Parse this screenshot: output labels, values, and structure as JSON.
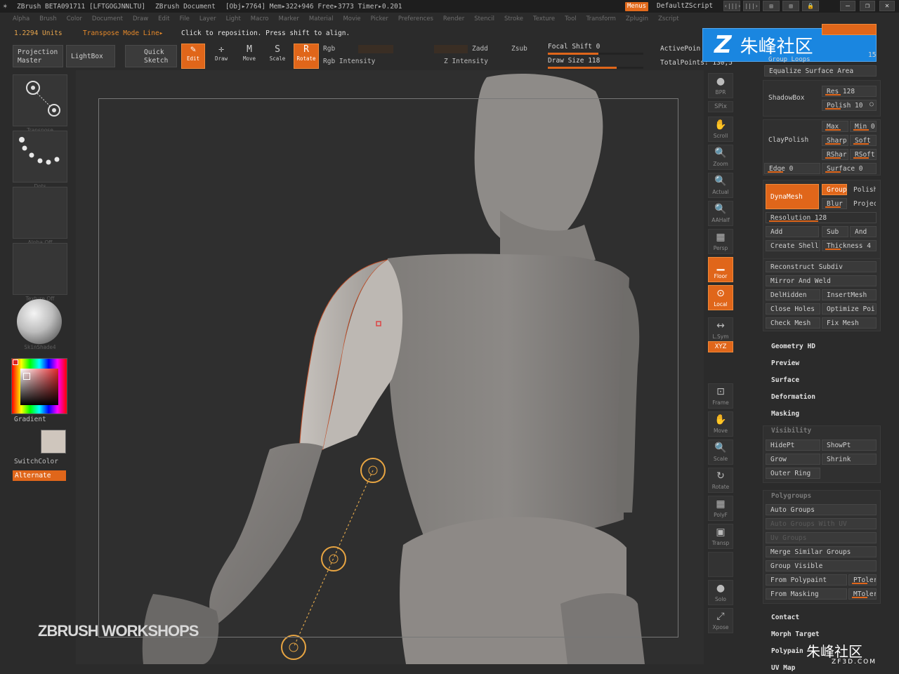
{
  "titlebar": {
    "app": "ZBrush BETA091711 [LFTGOGJNNLTU]",
    "document": "ZBrush Document",
    "stats": "[Obj▸7764] Mem▸322+946 Free▸3773 Timer▸0.201",
    "menus_label": "Menus",
    "script_label": "DefaultZScript"
  },
  "menubar": [
    "Alpha",
    "Brush",
    "Color",
    "Document",
    "Draw",
    "Edit",
    "File",
    "Layer",
    "Light",
    "Macro",
    "Marker",
    "Material",
    "Movie",
    "Picker",
    "Preferences",
    "Render",
    "Stencil",
    "Stroke",
    "Texture",
    "Tool",
    "Transform",
    "Zplugin",
    "Zscript"
  ],
  "infobar": {
    "units": "1.2294 Units",
    "mode": "Transpose Mode Line▸",
    "tip": "Click to reposition. Press shift to align."
  },
  "toolbar": {
    "projection_master": "Projection Master",
    "lightbox": "LightBox",
    "quick_sketch": "Quick Sketch",
    "edit": "Edit",
    "draw": "Draw",
    "move": "Move",
    "scale": "Scale",
    "rotate": "Rotate",
    "rgb": "Rgb",
    "zadd": "Zadd",
    "zsub": "Zsub",
    "rgb_intensity": "Rgb Intensity",
    "z_intensity": "Z Intensity",
    "focal_shift": "Focal Shift 0",
    "draw_size": "Draw Size 118",
    "active_points": "ActivePoin",
    "total_points": "TotalPoints: 130,5"
  },
  "left_shelf": {
    "transpose_caption": "Transpose",
    "dots_caption": "Dots",
    "alpha_caption": "Alpha Off",
    "texture_caption": "Texture Off",
    "material_caption": "SkinShade4",
    "gradient": "Gradient",
    "switch_color": "SwitchColor",
    "alternate": "Alternate"
  },
  "viewport": {
    "watermark": "ZBRUSH WORKSHOPS"
  },
  "right_shelf": [
    {
      "icon": "bpr-icon",
      "glyph": "●",
      "label": "BPR",
      "orange": false
    },
    {
      "icon": "spix-icon",
      "glyph": "",
      "label": "SPix",
      "orange": false
    },
    {
      "icon": "scroll-icon",
      "glyph": "✋",
      "label": "Scroll",
      "orange": false
    },
    {
      "icon": "zoom-icon",
      "glyph": "🔍",
      "label": "Zoom",
      "orange": false
    },
    {
      "icon": "actual-icon",
      "glyph": "🔍",
      "label": "Actual",
      "orange": false
    },
    {
      "icon": "aahalf-icon",
      "glyph": "🔍",
      "label": "AAHalf",
      "orange": false
    },
    {
      "icon": "persp-icon",
      "glyph": "▦",
      "label": "Persp",
      "orange": false
    },
    {
      "icon": "floor-icon",
      "glyph": "▁",
      "label": "Floor",
      "orange": true
    },
    {
      "icon": "local-icon",
      "glyph": "⊙",
      "label": "Local",
      "orange": true
    },
    {
      "icon": "lsym-icon",
      "glyph": "↔",
      "label": "L.Sym",
      "orange": false
    },
    {
      "icon": "xyz-icon",
      "glyph": "",
      "label": "XYZ",
      "orange": true
    },
    {
      "icon": "frame-icon",
      "glyph": "⊡",
      "label": "Frame",
      "orange": false
    },
    {
      "icon": "move-icon",
      "glyph": "✋",
      "label": "Move",
      "orange": false
    },
    {
      "icon": "scale-icon",
      "glyph": "🔍",
      "label": "Scale",
      "orange": false
    },
    {
      "icon": "rotate-icon",
      "glyph": "↻",
      "label": "Rotate",
      "orange": false
    },
    {
      "icon": "polyf-icon",
      "glyph": "▦",
      "label": "PolyF",
      "orange": false
    },
    {
      "icon": "transp-icon",
      "glyph": "▣",
      "label": "Transp",
      "orange": false
    },
    {
      "icon": "ghost-icon",
      "glyph": "",
      "label": "",
      "orange": false
    },
    {
      "icon": "solo-icon",
      "glyph": "●",
      "label": "Solo",
      "orange": false
    },
    {
      "icon": "xpose-icon",
      "glyph": "⤢",
      "label": "Xpose",
      "orange": false
    }
  ],
  "tray": {
    "top_header": "Group Loops",
    "top_value": "15",
    "equalize": "Equalize Surface Area",
    "shadowbox": "ShadowBox",
    "res": "Res 128",
    "polish": "Polish 10",
    "claypolish": "ClayPolish",
    "max": "Max",
    "min": "Min 0",
    "sharp": "Sharp",
    "soft": "Soft",
    "rshar": "RShar",
    "rsoft": "RSoft",
    "edge": "Edge 0",
    "surface_val": "Surface 0",
    "dynamesh": "DynaMesh",
    "group": "Group",
    "polish2": "Polish",
    "blur": "Blur",
    "project": "Projec",
    "resolution": "Resolution 128",
    "add": "Add",
    "sub": "Sub",
    "and": "And",
    "create_shell": "Create Shell",
    "thickness": "Thickness 4",
    "reconstruct": "Reconstruct Subdiv",
    "mirror_weld": "Mirror And Weld",
    "delhidden": "DelHidden",
    "insertmesh": "InsertMesh",
    "close_holes": "Close Holes",
    "optimize": "Optimize Poi",
    "check_mesh": "Check Mesh",
    "fix_mesh": "Fix Mesh",
    "geometry_hd": "Geometry HD",
    "preview": "Preview",
    "surface": "Surface",
    "deformation": "Deformation",
    "masking": "Masking",
    "visibility": "Visibility",
    "hidept": "HidePt",
    "showpt": "ShowPt",
    "grow": "Grow",
    "shrink": "Shrink",
    "outer_ring": "Outer Ring",
    "polygroups": "Polygroups",
    "auto_groups": "Auto Groups",
    "auto_groups_uv": "Auto Groups With UV",
    "uv_groups": "Uv Groups",
    "merge_similar": "Merge Similar Groups",
    "group_visible": "Group Visible",
    "from_polypaint": "From Polypaint",
    "ptoler": "PToler",
    "from_masking": "From Masking",
    "mtoler": "MToler",
    "contact": "Contact",
    "morph_target": "Morph Target",
    "polypaint": "Polypain",
    "uv_map": "UV Map"
  },
  "watermarks": {
    "site_cn": "朱峰社区",
    "site_url": "ZF3D.COM"
  },
  "colors": {
    "accent": "#e0661a",
    "mesh": "#8f8b87",
    "overlay_blue": "#1a86e0"
  }
}
